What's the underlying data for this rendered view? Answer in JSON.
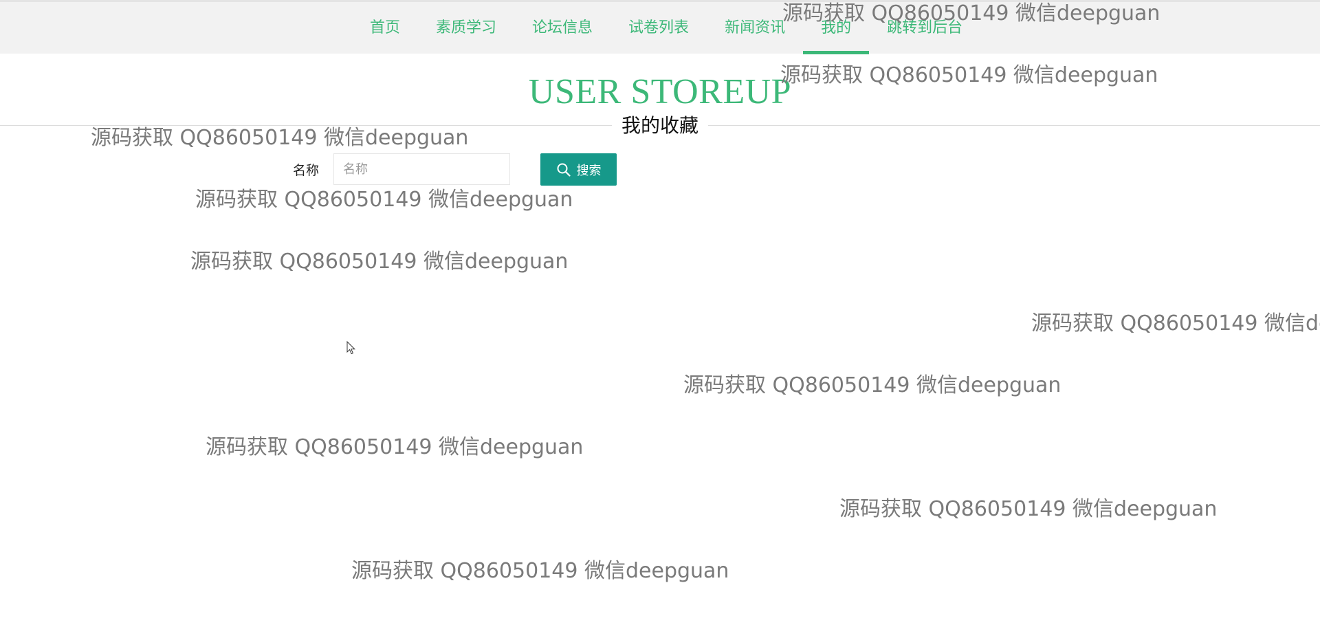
{
  "nav": {
    "items": [
      {
        "label": "首页"
      },
      {
        "label": "素质学习"
      },
      {
        "label": "论坛信息"
      },
      {
        "label": "试卷列表"
      },
      {
        "label": "新闻资讯"
      },
      {
        "label": "我的"
      },
      {
        "label": "跳转到后台"
      }
    ],
    "active_index": 5
  },
  "header": {
    "title_en": "USER STOREUP",
    "title_cn": "我的收藏"
  },
  "search": {
    "label": "名称",
    "placeholder": "名称",
    "value": "",
    "button_label": "搜索"
  },
  "watermark": {
    "text": "源码获取 QQ86050149 微信deepguan"
  },
  "colors": {
    "accent": "#3cb878",
    "button": "#16998a",
    "nav_bg": "#f2f2f2",
    "watermark": "#7a7a7a"
  },
  "icons": {
    "search_button": "search-icon",
    "pointer": "mouse-cursor-icon"
  }
}
